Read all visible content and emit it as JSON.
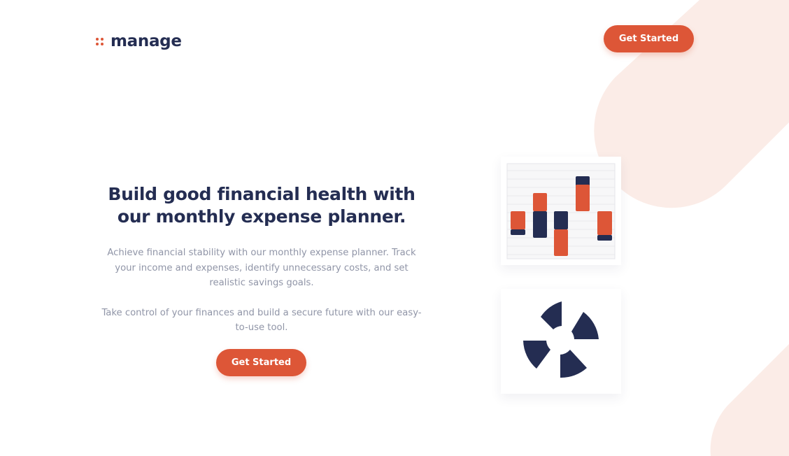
{
  "brand": {
    "logo_text": "manage",
    "accent": "#dd5637",
    "navy": "#242d52",
    "muted_text": "#9095a7",
    "bg_pink": "#fbece7"
  },
  "header": {
    "cta_label": "Get Started"
  },
  "hero": {
    "title_line1": "Build good financial health with",
    "title_line2": "our monthly expense planner.",
    "paragraph1": "Achieve financial stability with our monthly expense planner. Track your income and expenses, identify unnecessary costs, and set realistic savings goals.",
    "paragraph2": "Take control of your finances and build a secure future with our easy-to-use tool.",
    "cta_label": "Get Started"
  },
  "illustrations": {
    "bar_chart_icon": "stacked-bar-chart-illustration",
    "donut_icon": "segmented-ring-illustration"
  }
}
